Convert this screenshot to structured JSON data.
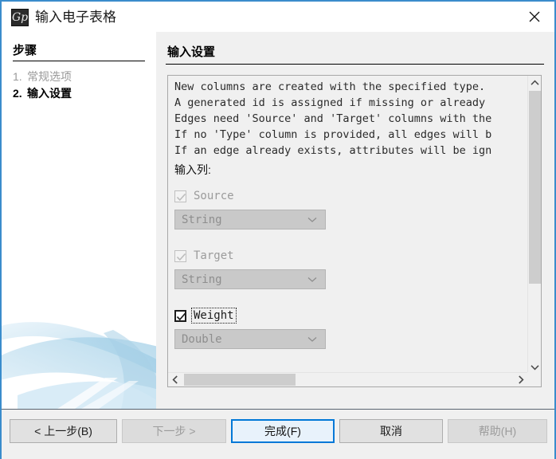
{
  "window": {
    "title": "输入电子表格",
    "icon": "gephi-logo-icon",
    "close_icon": "close-icon"
  },
  "steps_panel": {
    "heading": "步骤",
    "items": [
      {
        "number": "1.",
        "label": "常规选项",
        "current": false
      },
      {
        "number": "2.",
        "label": "输入设置",
        "current": true
      }
    ]
  },
  "settings_panel": {
    "heading": "输入设置",
    "description": "New columns are created with the specified type.\nA generated id is assigned if missing or already\nEdges need 'Source' and 'Target' columns with the\nIf no 'Type' column is provided, all edges will b\nIf an edge already exists, attributes will be ign",
    "columns_label": "输入列:",
    "columns": [
      {
        "name": "Source",
        "checked": true,
        "enabled": false,
        "focused": false,
        "type_value": "String",
        "type_enabled": false
      },
      {
        "name": "Target",
        "checked": true,
        "enabled": false,
        "focused": false,
        "type_value": "String",
        "type_enabled": false
      },
      {
        "name": "Weight",
        "checked": true,
        "enabled": true,
        "focused": true,
        "type_value": "Double",
        "type_enabled": false
      }
    ],
    "scrollbars": {
      "vertical_up_icon": "chevron-up-icon",
      "vertical_down_icon": "chevron-down-icon",
      "horizontal_left_icon": "chevron-left-icon",
      "horizontal_right_icon": "chevron-right-icon"
    }
  },
  "buttons": {
    "back": {
      "label": "< 上一步(B)",
      "enabled": true,
      "default": false
    },
    "next": {
      "label": "下一步 >",
      "enabled": false,
      "default": false
    },
    "finish": {
      "label": "完成(F)",
      "enabled": true,
      "default": true
    },
    "cancel": {
      "label": "取消",
      "enabled": true,
      "default": false
    },
    "help": {
      "label": "帮助(H)",
      "enabled": false,
      "default": false
    }
  },
  "colors": {
    "accent": "#3a8ccc",
    "default_button_border": "#0078d7",
    "panel_bg": "#f0f0f0",
    "white": "#ffffff",
    "disabled_text": "#9c9c9c",
    "decor_blue": "#bedcee"
  }
}
